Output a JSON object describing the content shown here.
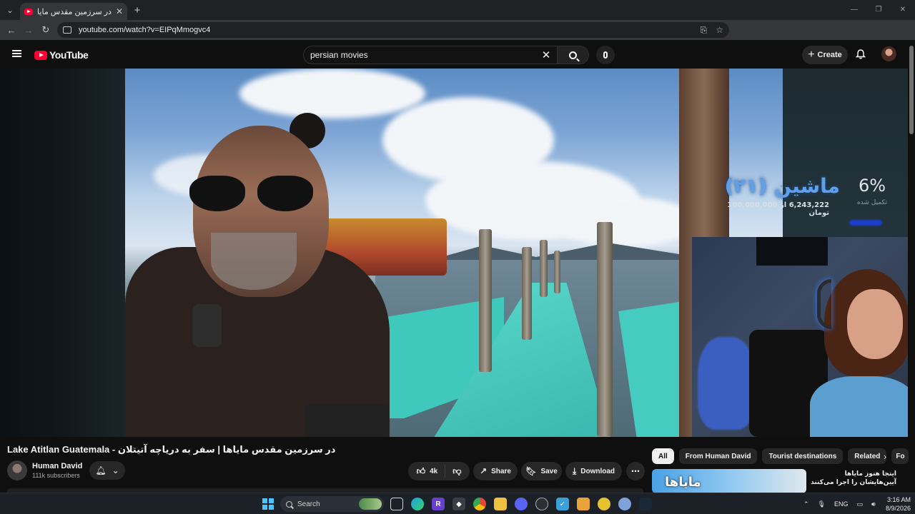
{
  "browser": {
    "tab_title": "در سرزمین مقدس مایاها | سفر به",
    "url": "youtube.com/watch?v=EIPqMmogvc4"
  },
  "youtube": {
    "logo_text": "YouTube",
    "search": {
      "value": "persian movies"
    },
    "create_label": "Create"
  },
  "overlay": {
    "title": "ماشین (۲۱)",
    "progress_text": "6,243,222 از 100,000,000 تومان",
    "percent": "6%",
    "percent_label": "تکمیل شده",
    "percent_value": 6.24
  },
  "video": {
    "title": "Lake Atitlan Guatemala - در سرزمین مقدس مایاها | سفر به دریاچه آتیتلان",
    "channel": "Human David",
    "subscribers": "111k subscribers",
    "like_count": "4k",
    "share_label": "Share",
    "save_label": "Save",
    "download_label": "Download"
  },
  "sidebar": {
    "chips": [
      "All",
      "From Human David",
      "Tourist destinations",
      "Related",
      "Fo"
    ],
    "recommendation": {
      "thumb_text": "مایاها",
      "title": "اینجا هنوز مایاها آیین‌هایشان را اجرا می‌کنند -"
    }
  },
  "taskbar": {
    "search_label": "Search",
    "lang": "ENG",
    "time": "3:16 AM",
    "date": "8/9/2026"
  },
  "colors": {
    "yt_red": "#ff0033",
    "background": "#0f0f0f",
    "overlay_accent": "#5fa0e8"
  }
}
